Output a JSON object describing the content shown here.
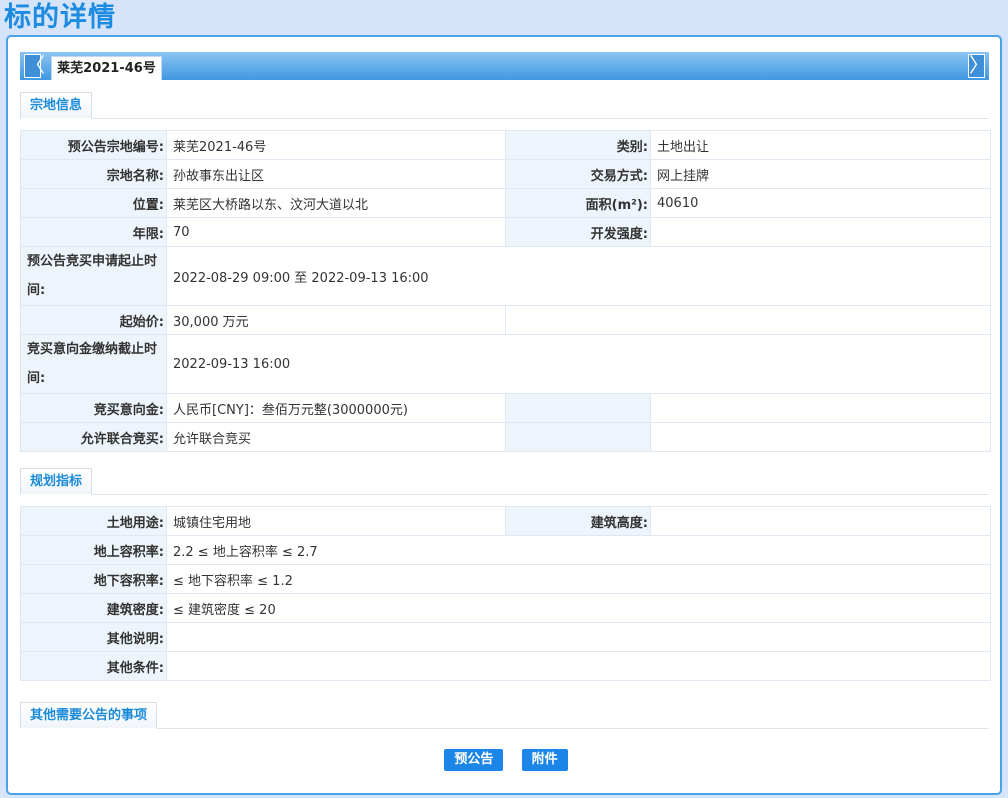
{
  "page": {
    "title": "标的详情"
  },
  "tabbar": {
    "active_tab": "莱芜2021-46号",
    "prev_arrow": "〈",
    "next_arrow": "〉"
  },
  "sections": {
    "parcel": "宗地信息",
    "planning": "规划指标",
    "other": "其他需要公告的事项"
  },
  "parcel": {
    "code_label": "预公告宗地编号:",
    "code": "莱芜2021-46号",
    "category_label": "类别:",
    "category": "土地出让",
    "name_label": "宗地名称:",
    "name": "孙故事东出让区",
    "trade_mode_label": "交易方式:",
    "trade_mode": "网上挂牌",
    "location_label": "位置:",
    "location": "莱芜区大桥路以东、汶河大道以北",
    "area_label": "面积(m²):",
    "area": "40610",
    "term_label": "年限:",
    "term": "70",
    "intensity_label": "开发强度:",
    "intensity": "",
    "apply_period_label": "预公告竞买申请起止时间:",
    "apply_period": "2022-08-29 09:00 至 2022-09-13 16:00",
    "start_price_label": "起始价:",
    "start_price": "30,000 万元",
    "deposit_deadline_label": "竞买意向金缴纳截止时间:",
    "deposit_deadline": "2022-09-13 16:00",
    "deposit_label": "竞买意向金:",
    "deposit": "人民币[CNY]：叁佰万元整(3000000元)",
    "joint_label": "允许联合竞买:",
    "joint": "允许联合竞买"
  },
  "planning": {
    "use_label": "土地用途:",
    "use": "城镇住宅用地",
    "height_label": "建筑高度:",
    "height": "",
    "far_above_label": "地上容积率:",
    "far_above": "2.2 ≤ 地上容积率 ≤ 2.7",
    "far_below_label": "地下容积率:",
    "far_below": "≤ 地下容积率 ≤ 1.2",
    "density_label": "建筑密度:",
    "density": "≤ 建筑密度 ≤ 20",
    "other_note_label": "其他说明:",
    "other_note": "",
    "other_cond_label": "其他条件:",
    "other_cond": ""
  },
  "buttons": {
    "pre_notice": "预公告",
    "attachment": "附件"
  }
}
